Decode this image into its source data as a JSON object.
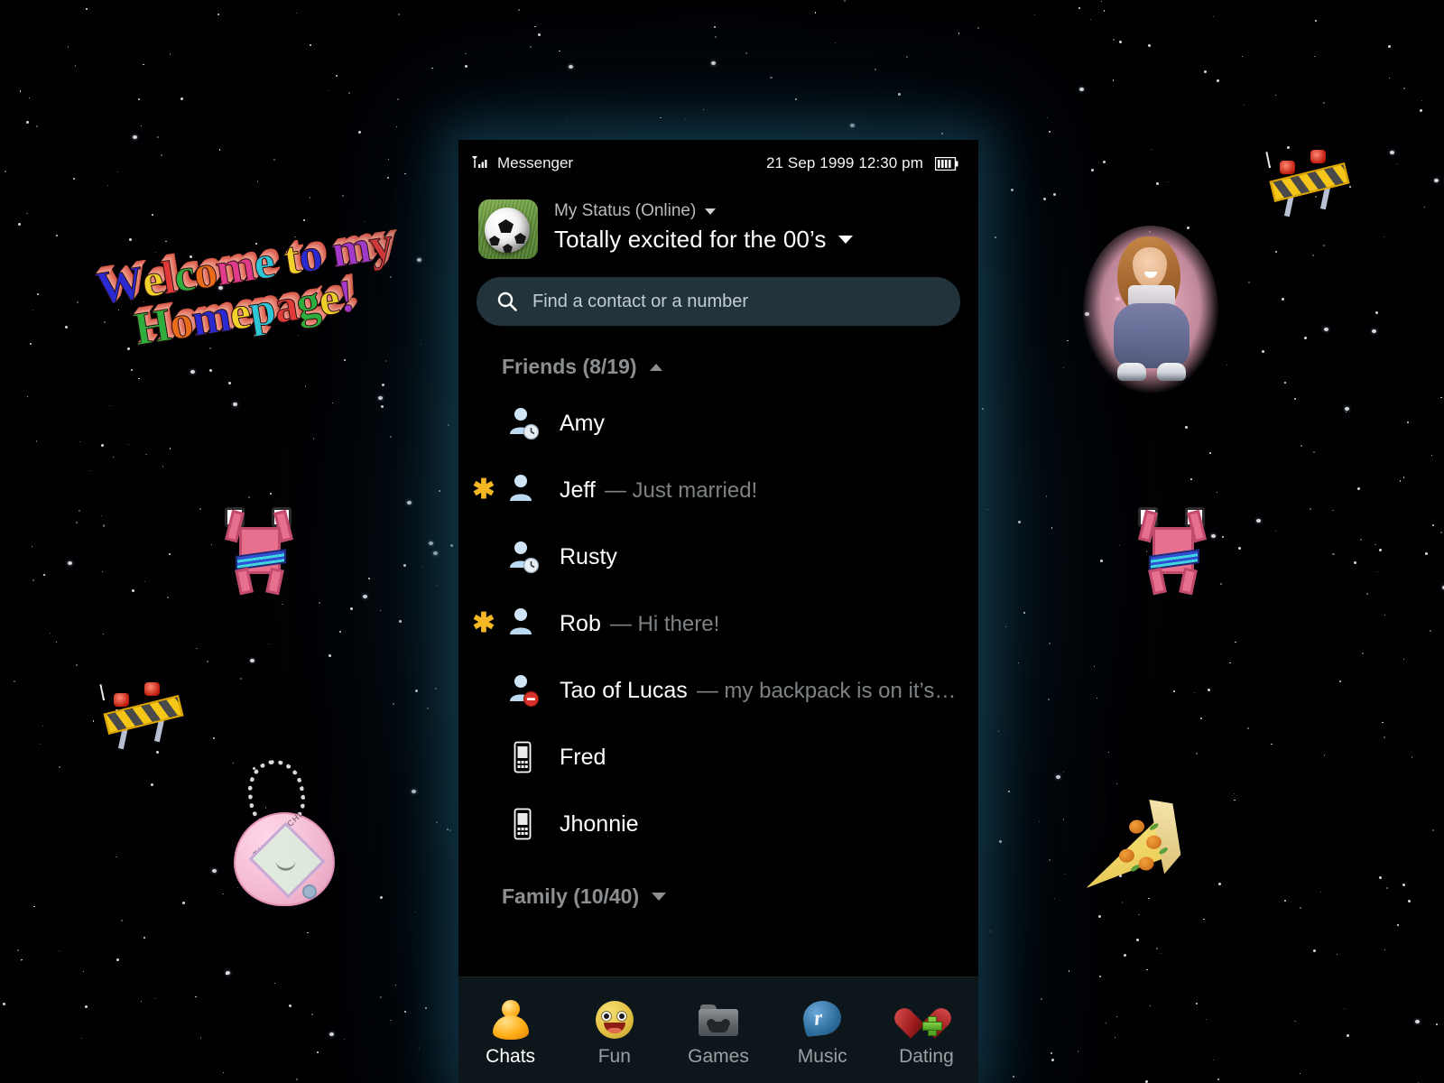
{
  "statusbar": {
    "app_name": "Messenger",
    "signal_icon": "signal-bars-icon",
    "datetime": "21 Sep 1999 12:30 pm",
    "battery_icon": "battery-full-icon"
  },
  "profile": {
    "avatar_icon": "soccer-ball-avatar",
    "status_label": "My Status (Online)",
    "status_caret": "chevron-down-icon",
    "mood_text": "Totally excited for the 00’s",
    "mood_caret": "chevron-down-icon"
  },
  "search": {
    "icon": "search-icon",
    "placeholder": "Find a contact or a number",
    "value": ""
  },
  "groups": [
    {
      "label": "Friends (8/19)",
      "expanded": true,
      "caret": "chevron-up-icon",
      "contacts": [
        {
          "name": "Amy",
          "message": "",
          "icon": "buddy-away-icon",
          "unread": false
        },
        {
          "name": "Jeff",
          "message": "— Just married!",
          "icon": "buddy-icon",
          "unread": true
        },
        {
          "name": "Rusty",
          "message": "",
          "icon": "buddy-away-icon",
          "unread": false
        },
        {
          "name": "Rob",
          "message": "— Hi there!",
          "icon": "buddy-icon",
          "unread": true
        },
        {
          "name": "Tao of Lucas",
          "message": "— my backpack is on it’s…",
          "icon": "buddy-busy-icon",
          "unread": false
        },
        {
          "name": "Fred",
          "message": "",
          "icon": "mobile-phone-icon",
          "unread": false
        },
        {
          "name": "Jhonnie",
          "message": "",
          "icon": "mobile-phone-icon",
          "unread": false
        }
      ]
    },
    {
      "label": "Family (10/40)",
      "expanded": false,
      "caret": "chevron-down-icon",
      "contacts": []
    }
  ],
  "tabbar": {
    "items": [
      {
        "label": "Chats",
        "icon": "msn-buddy-icon",
        "active": true
      },
      {
        "label": "Fun",
        "icon": "smiley-face-icon",
        "active": false
      },
      {
        "label": "Games",
        "icon": "game-folder-icon",
        "active": false
      },
      {
        "label": "Music",
        "icon": "realplayer-icon",
        "active": false
      },
      {
        "label": "Dating",
        "icon": "heart-plus-icon",
        "active": false
      }
    ]
  },
  "desktop": {
    "wordart": {
      "line1": "Welcome to my",
      "line2": "Homepage!"
    },
    "stickers": [
      {
        "name": "pink-pixel-creature-left",
        "icon": "dancing-creature-gif"
      },
      {
        "name": "pink-pixel-creature-right",
        "icon": "dancing-creature-gif"
      },
      {
        "name": "under-construction-left",
        "icon": "construction-barrier-gif"
      },
      {
        "name": "under-construction-right",
        "icon": "construction-barrier-gif"
      },
      {
        "name": "tamagotchi",
        "icon": "tamagotchi-icon"
      },
      {
        "name": "pizza-slice",
        "icon": "pizza-slice-icon"
      },
      {
        "name": "popstar-cutout",
        "icon": "popstar-photo"
      }
    ]
  },
  "colors": {
    "accent_teal": "#22333c",
    "unread_star": "#f5b724",
    "panel_bg": "#000000",
    "tabbar_bg": "#0d161a",
    "muted_text": "#8c8f91",
    "glow": "#184e66"
  }
}
